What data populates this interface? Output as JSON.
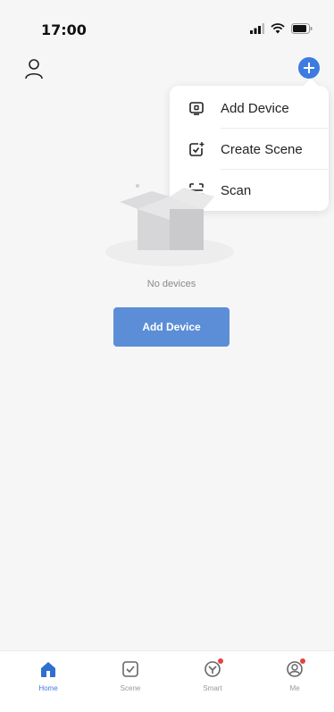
{
  "status_bar": {
    "time": "17:00"
  },
  "header": {
    "profile_icon": "person-icon",
    "add_icon": "plus-circle-icon"
  },
  "menu": {
    "items": [
      {
        "label": "Add Device",
        "icon": "device-icon"
      },
      {
        "label": "Create Scene",
        "icon": "create-scene-icon"
      },
      {
        "label": "Scan",
        "icon": "scan-icon"
      }
    ]
  },
  "empty_state": {
    "message": "No devices",
    "button_label": "Add Device"
  },
  "tab_bar": {
    "active": "Home",
    "tabs": [
      {
        "label": "Home",
        "icon": "home-icon",
        "badge": false
      },
      {
        "label": "Scene",
        "icon": "scene-icon",
        "badge": false
      },
      {
        "label": "Smart",
        "icon": "smart-icon",
        "badge": true
      },
      {
        "label": "Me",
        "icon": "me-icon",
        "badge": true
      }
    ]
  },
  "colors": {
    "accent": "#3d7be1",
    "button": "#5b8ed6",
    "badge": "#e2453c",
    "background": "#f6f6f7"
  }
}
